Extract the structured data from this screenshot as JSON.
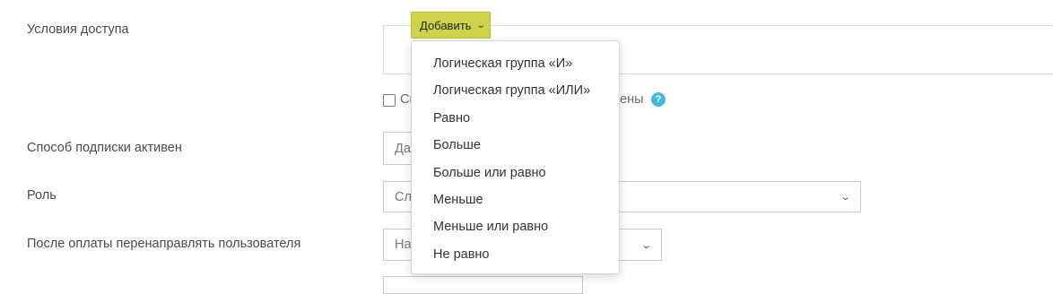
{
  "labels": {
    "access_conditions": "Условия доступа",
    "subscription_active": "Способ подписки активен",
    "role": "Роль",
    "redirect_after_payment": "После оплаты перенаправлять пользователя"
  },
  "add_button": {
    "label": "Добавить"
  },
  "checkbox": {
    "text_left": "Сп",
    "text_right": "ены"
  },
  "fields": {
    "subscription_value": "Да",
    "role_value": "Сл",
    "redirect_value": "На"
  },
  "menu": {
    "items": [
      "Логическая группа «И»",
      "Логическая группа «ИЛИ»",
      "Равно",
      "Больше",
      "Больше или равно",
      "Меньше",
      "Меньше или равно",
      "Не равно"
    ]
  },
  "colors": {
    "add_button": "#cfd34a",
    "help_icon": "#46b8da"
  },
  "icons": {
    "dropdown": "chevron-down-icon",
    "help": "question-icon"
  }
}
